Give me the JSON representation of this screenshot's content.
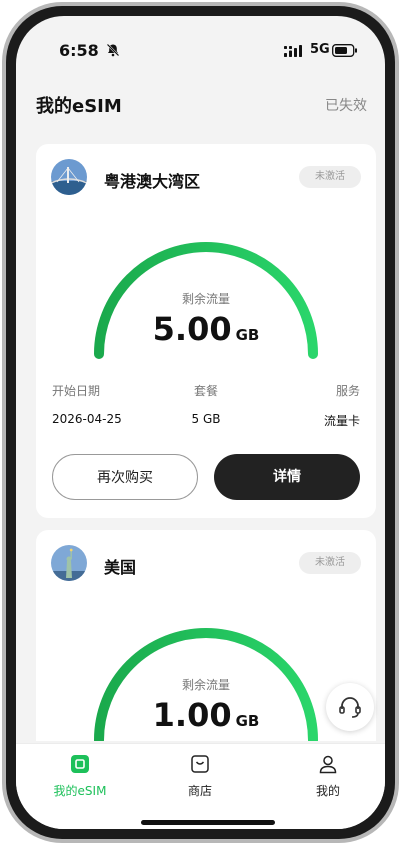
{
  "status_bar": {
    "time": "6:58",
    "network": "5G"
  },
  "header": {
    "title": "我的eSIM",
    "expired_link": "已失效"
  },
  "cards": [
    {
      "region": "粤港澳大湾区",
      "status": "未激活",
      "remaining_label": "剩余流量",
      "remaining_value": "5.00",
      "remaining_unit": "GB",
      "remaining_fraction": 1.0,
      "start_date_label": "开始日期",
      "start_date": "2026-04-25",
      "plan_label": "套餐",
      "plan": "5 GB",
      "service_label": "服务",
      "service": "流量卡",
      "buy_again_label": "再次购买",
      "details_label": "详情"
    },
    {
      "region": "美国",
      "status": "未激活",
      "remaining_label": "剩余流量",
      "remaining_value": "1.00",
      "remaining_unit": "GB",
      "remaining_fraction": 1.0
    }
  ],
  "tabbar": [
    {
      "label": "我的eSIM",
      "icon": "esim-icon",
      "active": true
    },
    {
      "label": "商店",
      "icon": "shop-icon",
      "active": false
    },
    {
      "label": "我的",
      "icon": "profile-icon",
      "active": false
    }
  ],
  "colors": {
    "accent": "#1dc05a",
    "dark_button": "#222222",
    "background": "#f3f3f3"
  }
}
